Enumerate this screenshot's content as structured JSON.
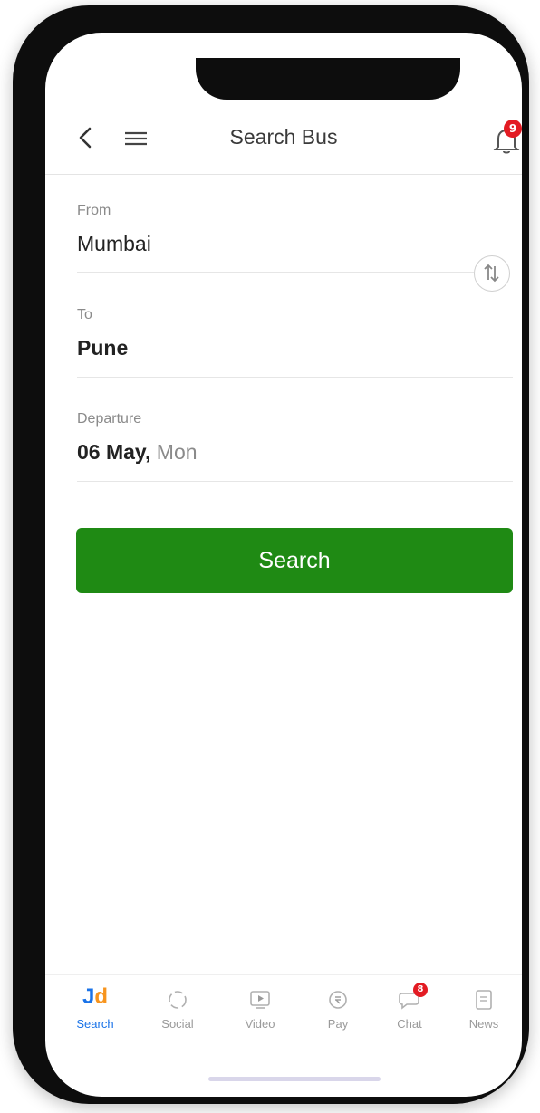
{
  "header": {
    "title": "Search Bus",
    "notification_count": "9"
  },
  "form": {
    "from": {
      "label": "From",
      "value": "Mumbai"
    },
    "to": {
      "label": "To",
      "value": "Pune"
    },
    "departure": {
      "label": "Departure",
      "day": "06 May,",
      "weekday": "Mon"
    },
    "search_label": "Search"
  },
  "bottom_nav": {
    "logo": {
      "j": "J",
      "d": "d"
    },
    "items": [
      {
        "label": "Search",
        "icon": "jd-logo-icon",
        "active": true
      },
      {
        "label": "Social",
        "icon": "social-icon"
      },
      {
        "label": "Video",
        "icon": "video-icon"
      },
      {
        "label": "Pay",
        "icon": "pay-icon"
      },
      {
        "label": "Chat",
        "icon": "chat-icon",
        "badge": "8"
      },
      {
        "label": "News",
        "icon": "news-icon"
      }
    ]
  },
  "colors": {
    "accent_green": "#1f8a14",
    "badge_red": "#e31b23",
    "brand_blue": "#1a73e8",
    "brand_orange": "#f7941d"
  }
}
